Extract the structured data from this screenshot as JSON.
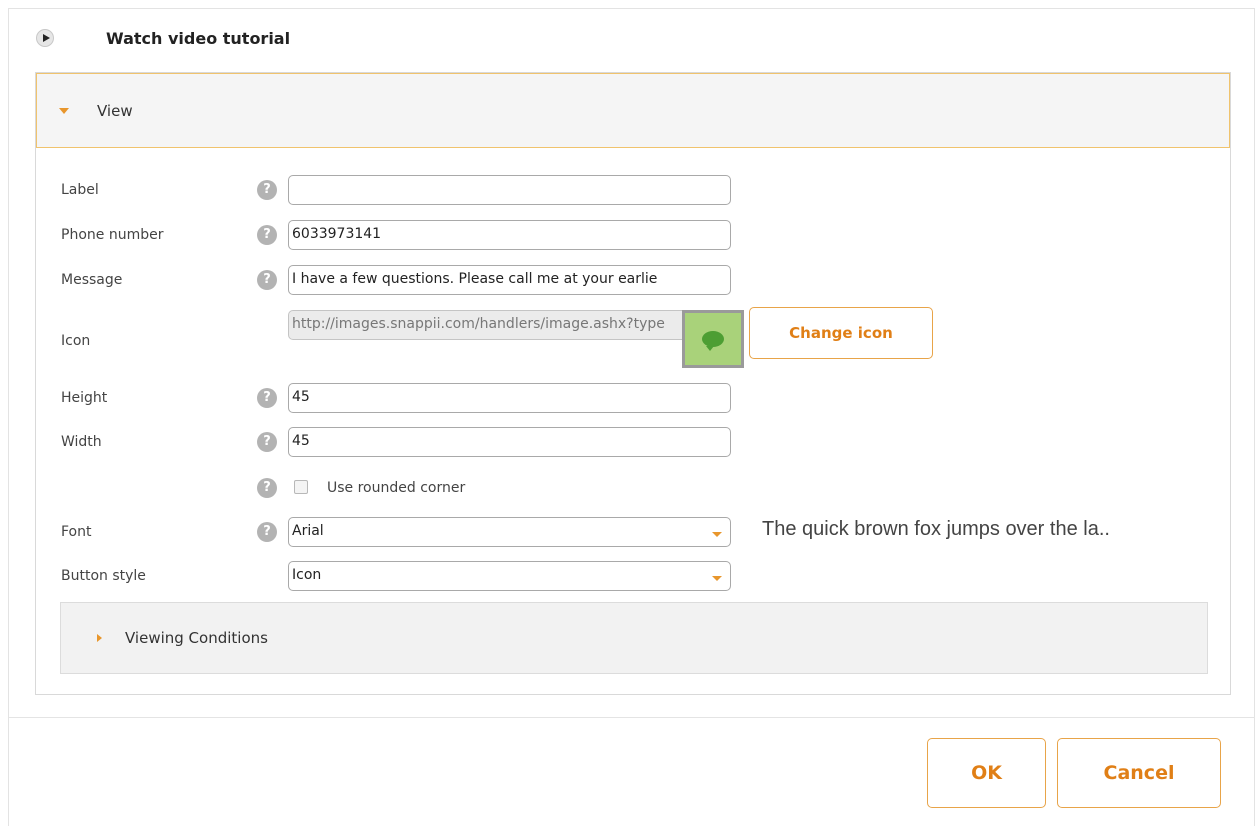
{
  "tutorial": {
    "label": "Watch video tutorial"
  },
  "view_panel": {
    "title": "View"
  },
  "form": {
    "label": {
      "label": "Label",
      "value": ""
    },
    "phone": {
      "label": "Phone number",
      "value": "6033973141"
    },
    "message": {
      "label": "Message",
      "value": "I have a few questions. Please call me at your earlie"
    },
    "icon": {
      "label": "Icon",
      "value": "http://images.snappii.com/handlers/image.ashx?type",
      "change_label": "Change icon"
    },
    "height": {
      "label": "Height",
      "value": "45"
    },
    "width": {
      "label": "Width",
      "value": "45"
    },
    "rounded": {
      "label": "Use rounded corner",
      "checked": false
    },
    "font": {
      "label": "Font",
      "value": "Arial",
      "preview": "The quick brown fox jumps over the la.."
    },
    "button_style": {
      "label": "Button style",
      "value": "Icon"
    }
  },
  "viewing_conditions": {
    "title": "Viewing Conditions"
  },
  "footer": {
    "ok_label": "OK",
    "cancel_label": "Cancel"
  },
  "help_icon_glyph": "?",
  "colors": {
    "accent": "#e07f16",
    "header_border": "#f0c36d",
    "icon_bg": "#a9d27a"
  }
}
